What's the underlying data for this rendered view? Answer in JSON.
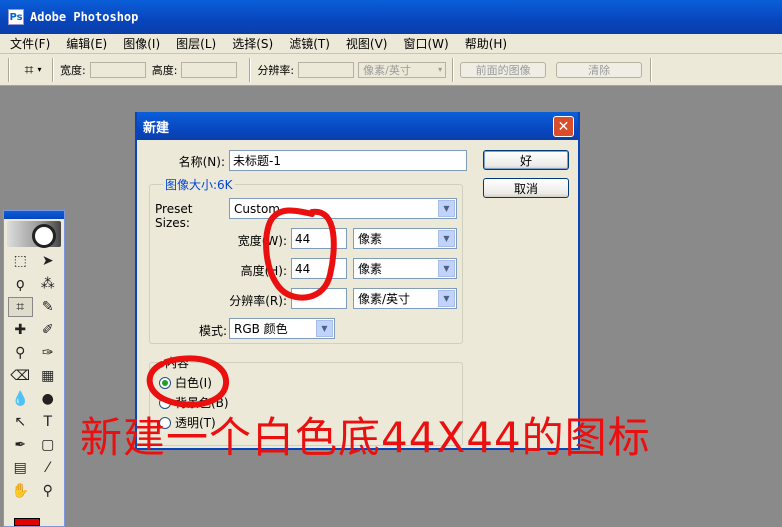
{
  "app": {
    "title": "Adobe Photoshop",
    "icon": "photoshop-icon"
  },
  "menu": [
    "文件(F)",
    "编辑(E)",
    "图像(I)",
    "图层(L)",
    "选择(S)",
    "滤镜(T)",
    "视图(V)",
    "窗口(W)",
    "帮助(H)"
  ],
  "options": {
    "tool_icon": "crop-icon",
    "width_label": "宽度:",
    "height_label": "高度:",
    "resolution_label": "分辨率:",
    "resolution_unit": "像素/英寸",
    "front_image_button": "前面的图像",
    "clear_button": "清除"
  },
  "toolbox": {
    "tools": [
      "marquee-icon",
      "move-icon",
      "lasso-icon",
      "magic-wand-icon",
      "crop-icon",
      "slice-icon",
      "healing-brush-icon",
      "brush-icon",
      "clone-stamp-icon",
      "history-brush-icon",
      "eraser-icon",
      "gradient-icon",
      "blur-icon",
      "dodge-icon",
      "path-selection-icon",
      "type-icon",
      "pen-icon",
      "shape-icon",
      "notes-icon",
      "eyedropper-icon",
      "hand-icon",
      "zoom-icon"
    ],
    "foreground_color": "#e00000"
  },
  "dialog": {
    "title": "新建",
    "name_label": "名称(N):",
    "name_value": "未标题-1",
    "ok_button": "好",
    "cancel_button": "取消",
    "image_size_label": "图像大小:6K",
    "preset_label": "Preset Sizes:",
    "preset_value": "Custom",
    "width_label": "宽度(W):",
    "width_value": "44",
    "width_unit": "像素",
    "height_label": "高度(H):",
    "height_value": "44",
    "height_unit": "像素",
    "resolution_label": "分辨率(R):",
    "resolution_value": "",
    "resolution_unit": "像素/英寸",
    "mode_label": "模式:",
    "mode_value": "RGB 颜色",
    "contents_label": "内容",
    "contents_options": [
      {
        "label": "白色(I)",
        "selected": true
      },
      {
        "label": "背景色(B)",
        "selected": false
      },
      {
        "label": "透明(T)",
        "selected": false
      }
    ]
  },
  "annotation": {
    "caption": "新建一个白色底44X44的图标",
    "color": "#ea1010"
  }
}
